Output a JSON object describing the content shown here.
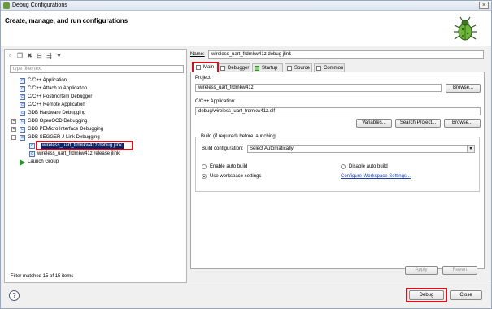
{
  "window": {
    "title": "Debug Configurations",
    "close_symbol": "×"
  },
  "banner": {
    "heading": "Create, manage, and run configurations"
  },
  "left_panel": {
    "toolbar": [
      {
        "icon": "new-config-icon",
        "glyph": "▫"
      },
      {
        "icon": "duplicate-icon",
        "glyph": "❐"
      },
      {
        "icon": "delete-icon",
        "glyph": "✖"
      },
      {
        "icon": "collapse-all-icon",
        "glyph": "⊟"
      },
      {
        "icon": "filter-icon",
        "glyph": "⇶"
      },
      {
        "icon": "dropdown-icon",
        "glyph": "▾"
      }
    ],
    "filter_placeholder": "type filter text",
    "tree": [
      {
        "label": "C/C++ Application"
      },
      {
        "label": "C/C++ Attach to Application"
      },
      {
        "label": "C/C++ Postmortem Debugger"
      },
      {
        "label": "C/C++ Remote Application"
      },
      {
        "label": "GDB Hardware Debugging"
      },
      {
        "label": "GDB OpenOCD Debugging",
        "toggle": "+"
      },
      {
        "label": "GDB PEMicro Interface Debugging",
        "toggle": "+"
      },
      {
        "label": "GDB SEGGER J-Link Debugging",
        "toggle": "−"
      },
      {
        "label": "wireless_uart_frdmkw41z debug jlink",
        "selected": true
      },
      {
        "label": "wireless_uart_frdmkw41z release jlink"
      },
      {
        "label": "Launch Group"
      }
    ],
    "status": "Filter matched 15 of 15 items"
  },
  "name": {
    "label": "Name:",
    "value": "wireless_uart_frdmkw41z debug jlink"
  },
  "tabs": [
    "Main",
    "Debugger",
    "Startup",
    "Source",
    "Common"
  ],
  "main": {
    "project_label": "Project:",
    "project_value": "wireless_uart_frdmkw41z",
    "browse": "Browse...",
    "app_label": "C/C++ Application:",
    "app_value": "debug/wireless_uart_frdmkw41z.elf",
    "variables": "Variables...",
    "search_project": "Search Project...",
    "build_group": "Build (if required) before launching",
    "build_config_label": "Build configuration:",
    "build_config_value": "Select Automatically",
    "enable_auto": "Enable auto build",
    "disable_auto": "Disable auto build",
    "workspace_settings": "Use workspace settings",
    "configure_link": "Configure Workspace Settings..."
  },
  "actions": {
    "apply": "Apply",
    "revert": "Revert",
    "debug": "Debug",
    "close": "Close",
    "help": "?"
  }
}
